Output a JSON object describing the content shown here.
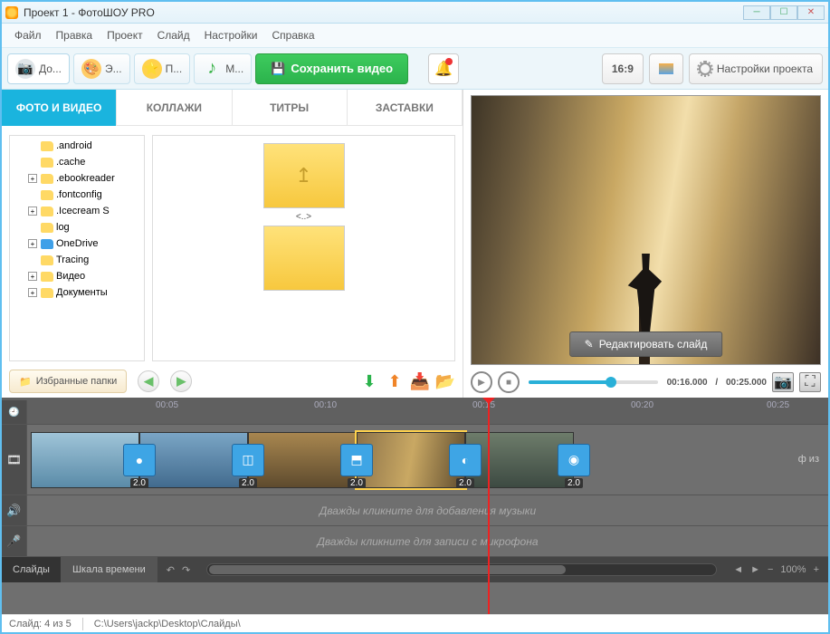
{
  "window": {
    "title": "Проект 1 - ФотоШОУ PRO"
  },
  "menu": {
    "file": "Файл",
    "edit": "Правка",
    "project": "Проект",
    "slide": "Слайд",
    "settings": "Настройки",
    "help": "Справка"
  },
  "toolbar": {
    "add": "До...",
    "effects": "Э...",
    "fav": "П...",
    "music": "М...",
    "save": "Сохранить видео",
    "aspect": "16:9",
    "proj_settings": "Настройки проекта"
  },
  "tabs": {
    "photo": "ФОТО И ВИДЕО",
    "collage": "КОЛЛАЖИ",
    "titles": "ТИТРЫ",
    "intro": "ЗАСТАВКИ"
  },
  "tree": {
    "items": [
      {
        "exp": "",
        "label": ".android"
      },
      {
        "exp": "",
        "label": ".cache"
      },
      {
        "exp": "+",
        "label": ".ebookreader"
      },
      {
        "exp": "",
        "label": ".fontconfig"
      },
      {
        "exp": "+",
        "label": ".Icecream S"
      },
      {
        "exp": "",
        "label": "log"
      },
      {
        "exp": "+",
        "label": "OneDrive",
        "cls": "onedrive"
      },
      {
        "exp": "",
        "label": "Tracing"
      },
      {
        "exp": "+",
        "label": "Видео"
      },
      {
        "exp": "+",
        "label": "Документы"
      }
    ]
  },
  "thumbs": {
    "up_label": "<..>"
  },
  "fav_button": "Избранные папки",
  "preview": {
    "edit": "Редактировать слайд",
    "time_cur": "00:16.000",
    "time_total": "00:25.000"
  },
  "ruler": {
    "t1": "00:05",
    "t2": "00:10",
    "t3": "00:15",
    "t4": "00:20",
    "t5": "00:25"
  },
  "transitions": {
    "dur": "2.0"
  },
  "tracks": {
    "music": "Дважды кликните для добавления музыки",
    "mic": "Дважды кликните для записи с микрофона"
  },
  "bottom": {
    "slides": "Слайды",
    "timeline": "Шкала времени",
    "zoom": "100%"
  },
  "status": {
    "slide": "Слайд: 4 из 5",
    "path": "C:\\Users\\jackp\\Desktop\\Слайды\\"
  },
  "timeline_right": "ф из"
}
